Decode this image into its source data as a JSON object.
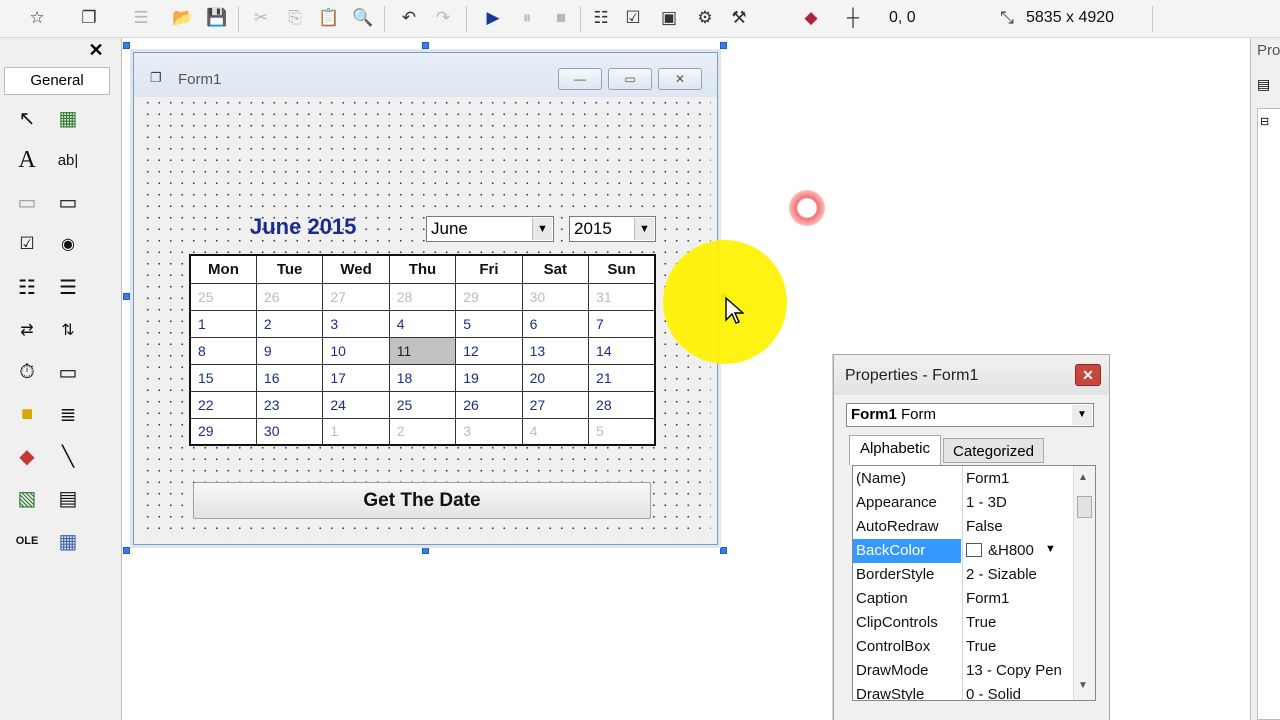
{
  "toolbar": {
    "position_readout": "0, 0",
    "size_readout": "5835 x 4920"
  },
  "toolbox": {
    "tab_label": "General"
  },
  "form": {
    "caption": "Form1",
    "month_label": "June 2015",
    "month_combo": "June",
    "year_combo": "2015",
    "weekdays": [
      "Mon",
      "Tue",
      "Wed",
      "Thu",
      "Fri",
      "Sat",
      "Sun"
    ],
    "weeks": [
      [
        "25",
        "26",
        "27",
        "28",
        "29",
        "30",
        "31"
      ],
      [
        "1",
        "2",
        "3",
        "4",
        "5",
        "6",
        "7"
      ],
      [
        "8",
        "9",
        "10",
        "11",
        "12",
        "13",
        "14"
      ],
      [
        "15",
        "16",
        "17",
        "18",
        "19",
        "20",
        "21"
      ],
      [
        "22",
        "23",
        "24",
        "25",
        "26",
        "27",
        "28"
      ],
      [
        "29",
        "30",
        "1",
        "2",
        "3",
        "4",
        "5"
      ]
    ],
    "selected_day": "11",
    "button_label": "Get The Date"
  },
  "properties": {
    "title": "Properties - Form1",
    "object_name": "Form1",
    "object_type": "Form",
    "tabs": [
      "Alphabetic",
      "Categorized"
    ],
    "rows": [
      {
        "name": "(Name)",
        "value": "Form1"
      },
      {
        "name": "Appearance",
        "value": "1 - 3D"
      },
      {
        "name": "AutoRedraw",
        "value": "False"
      },
      {
        "name": "BackColor",
        "value": "&H800"
      },
      {
        "name": "BorderStyle",
        "value": "2 - Sizable"
      },
      {
        "name": "Caption",
        "value": "Form1"
      },
      {
        "name": "ClipControls",
        "value": "True"
      },
      {
        "name": "ControlBox",
        "value": "True"
      },
      {
        "name": "DrawMode",
        "value": "13 - Copy Pen"
      },
      {
        "name": "DrawStyle",
        "value": "0 - Solid"
      }
    ]
  },
  "right_panel": {
    "title": "Pro"
  },
  "colors": {
    "calendar_text": "#1a2c8f",
    "selected_day_bg": "#c2c2c2",
    "selection_highlight": "#3399ff",
    "cursor_halo": "#fff200"
  }
}
